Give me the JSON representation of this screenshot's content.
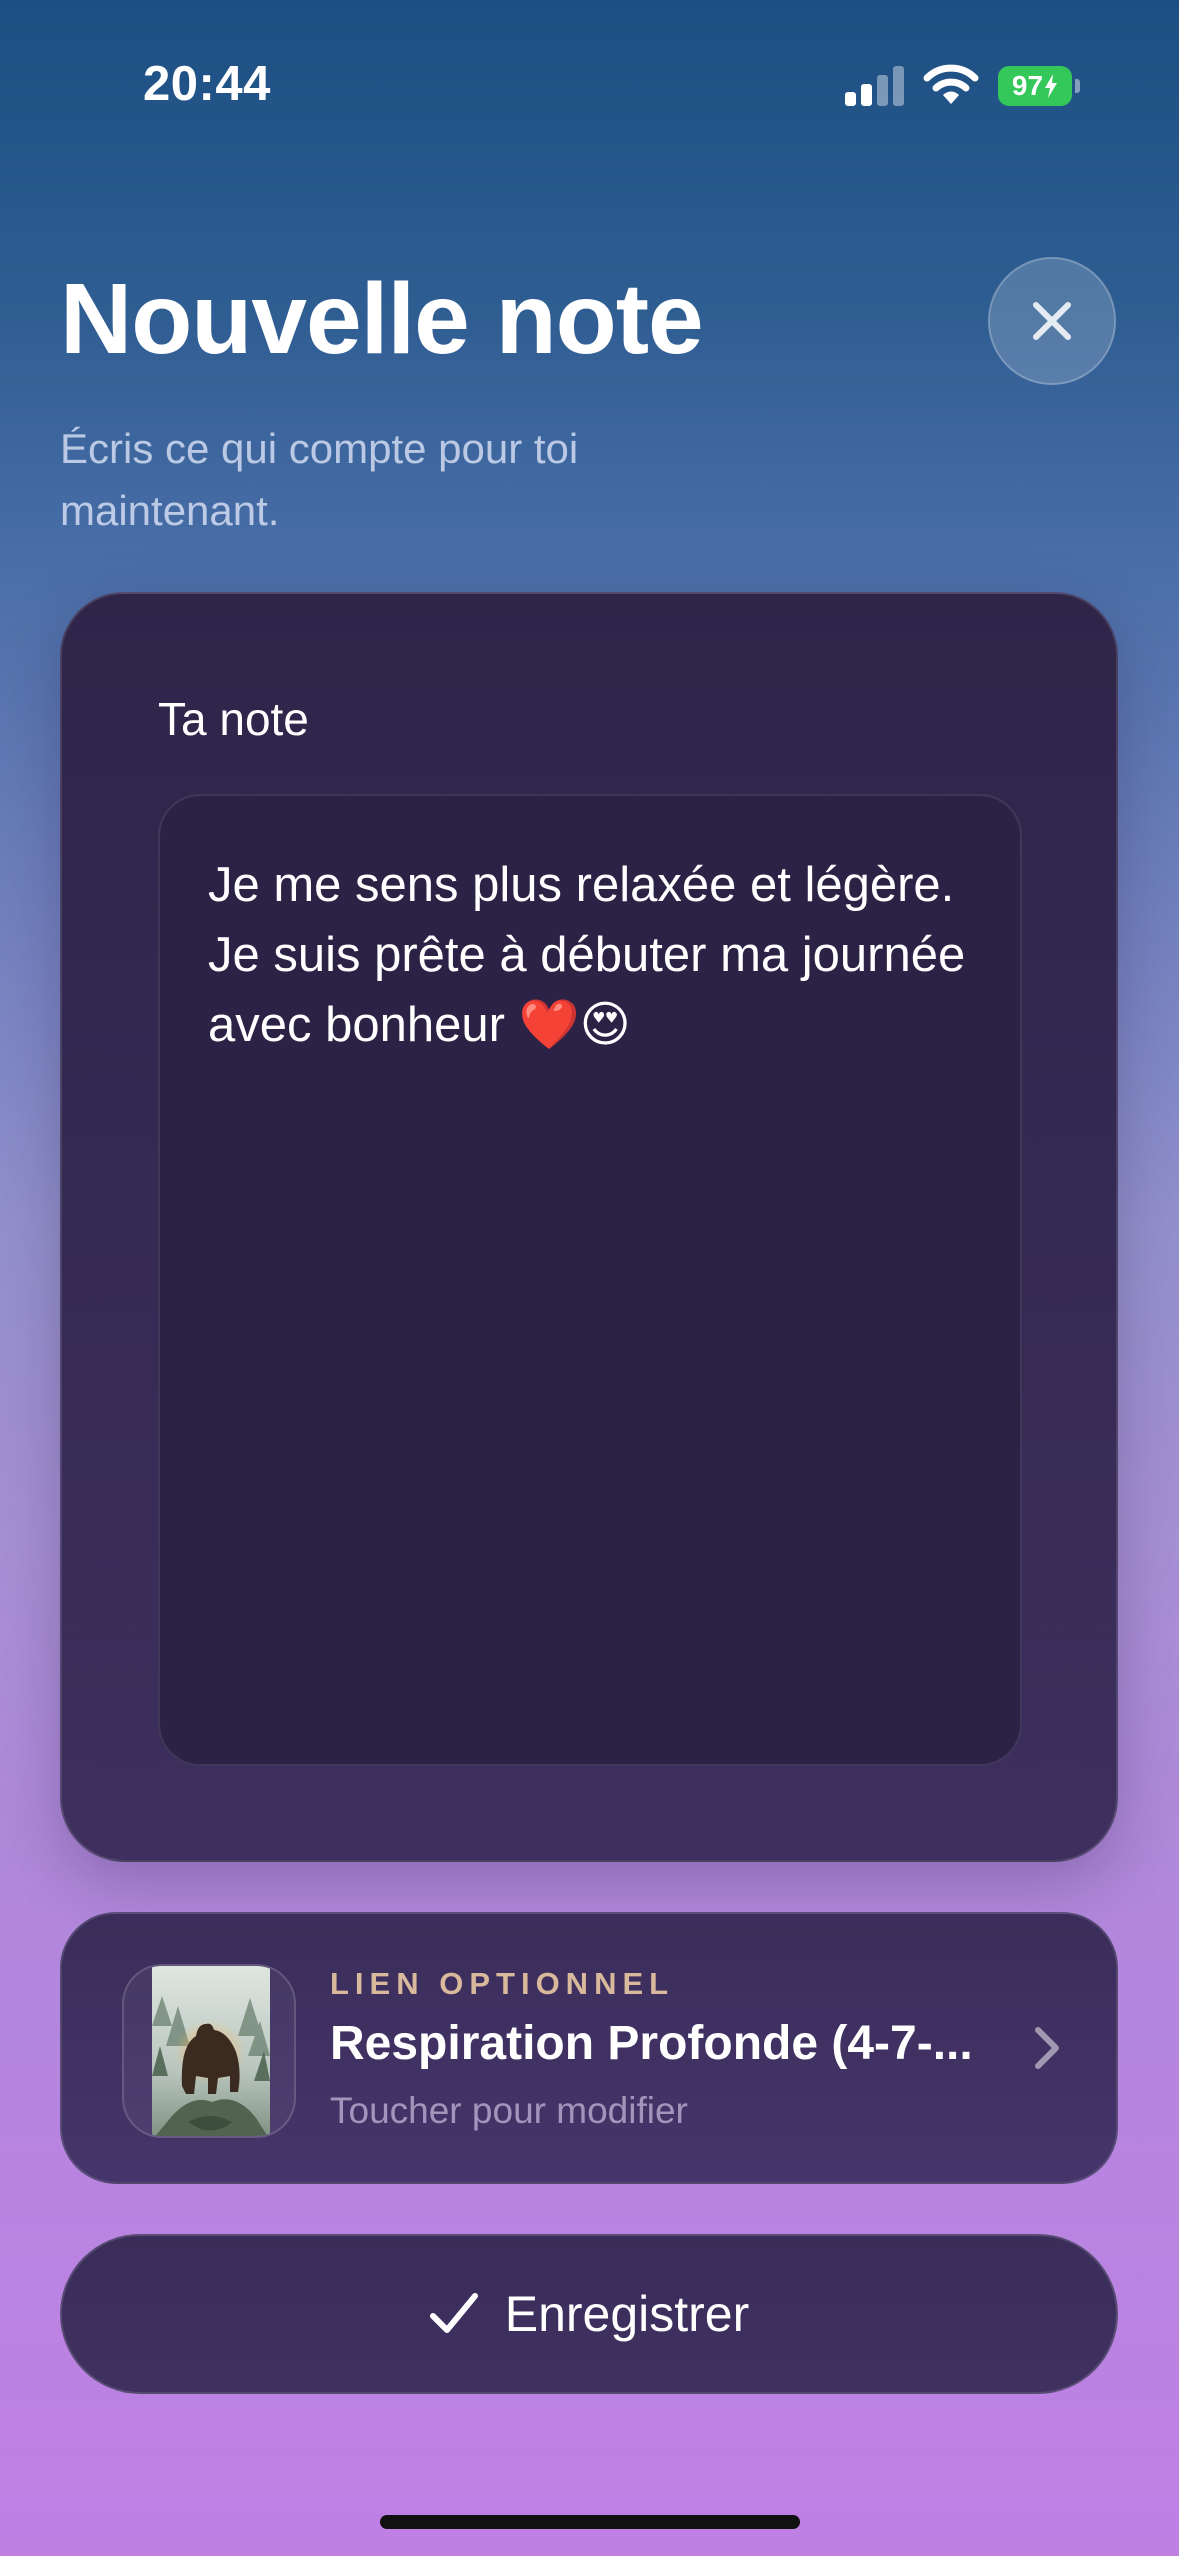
{
  "status_bar": {
    "time": "20:44",
    "battery_level": "97",
    "signal_bars_active": 2,
    "signal_bars_total": 4
  },
  "header": {
    "title": "Nouvelle note",
    "subtitle": "Écris ce qui compte pour toi maintenant."
  },
  "note": {
    "label": "Ta note",
    "value": "Je me sens plus relaxée et légère. Je suis prête à débuter ma journée avec bonheur ❤️😍"
  },
  "link": {
    "eyebrow": "LIEN OPTIONNEL",
    "title": "Respiration Profonde (4-7-...",
    "hint": "Toucher pour modifier"
  },
  "actions": {
    "save_label": "Enregistrer"
  },
  "colors": {
    "accent_eyebrow": "#d9b99b",
    "card_background": "#2f2549",
    "battery_green": "#34c759"
  }
}
